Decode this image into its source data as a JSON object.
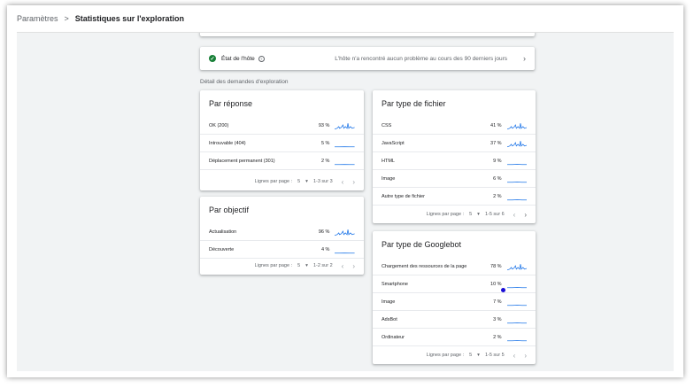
{
  "breadcrumb": {
    "parent": "Paramètres",
    "current": "Statistiques sur l'exploration"
  },
  "host": {
    "label": "État de l'hôte",
    "status": "L'hôte n'a rencontré aucun problème au cours des 90 derniers jours"
  },
  "section_title": "Détail des demandes d'exploration",
  "colors": {
    "accent": "#1a73e8",
    "ok": "#188038"
  },
  "icons": [
    "check-circle-icon",
    "help-icon",
    "chevron-right-icon",
    "dropdown-icon",
    "chevron-left-icon"
  ],
  "cards": {
    "response": {
      "title": "Par réponse",
      "rows": [
        {
          "label": "OK (200)",
          "pct": "93 %",
          "spark": "spiky"
        },
        {
          "label": "Introuvable (404)",
          "pct": "5 %",
          "spark": "flat"
        },
        {
          "label": "Déplacement permanent (301)",
          "pct": "2 %",
          "spark": "flat"
        }
      ],
      "pager": {
        "rows_label": "Lignes par page :",
        "size": "5",
        "range": "1-3 sur 3"
      }
    },
    "purpose": {
      "title": "Par objectif",
      "rows": [
        {
          "label": "Actualisation",
          "pct": "96 %",
          "spark": "spiky"
        },
        {
          "label": "Découverte",
          "pct": "4 %",
          "spark": "flat"
        }
      ],
      "pager": {
        "rows_label": "Lignes par page :",
        "size": "5",
        "range": "1-2 sur 2"
      }
    },
    "filetype": {
      "title": "Par type de fichier",
      "rows": [
        {
          "label": "CSS",
          "pct": "41 %",
          "spark": "spiky"
        },
        {
          "label": "JavaScript",
          "pct": "37 %",
          "spark": "spiky"
        },
        {
          "label": "HTML",
          "pct": "9 %",
          "spark": "flat"
        },
        {
          "label": "Image",
          "pct": "6 %",
          "spark": "flat"
        },
        {
          "label": "Autre type de fichier",
          "pct": "2 %",
          "spark": "flat"
        }
      ],
      "pager": {
        "rows_label": "Lignes par page :",
        "size": "5",
        "range": "1-5 sur 6"
      }
    },
    "googlebot": {
      "title": "Par type de Googlebot",
      "rows": [
        {
          "label": "Chargement des ressources de la page",
          "pct": "78 %",
          "spark": "spiky"
        },
        {
          "label": "Smartphone",
          "pct": "10 %",
          "spark": "flat"
        },
        {
          "label": "Image",
          "pct": "7 %",
          "spark": "flat"
        },
        {
          "label": "AdsBot",
          "pct": "3 %",
          "spark": "flat"
        },
        {
          "label": "Ordinateur",
          "pct": "2 %",
          "spark": "flat"
        }
      ],
      "pager": {
        "rows_label": "Lignes par page :",
        "size": "5",
        "range": "1-5 sur 5"
      }
    }
  }
}
